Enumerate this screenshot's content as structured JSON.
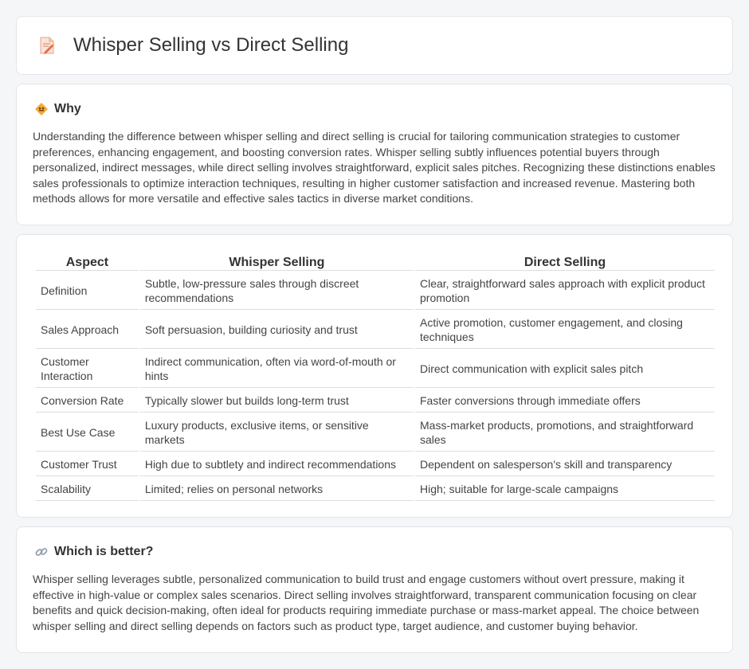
{
  "header": {
    "title": "Whisper Selling vs Direct Selling",
    "icon": "document-pencil-icon"
  },
  "why": {
    "title": "Why",
    "icon": "diamond-sign-icon",
    "text": "Understanding the difference between whisper selling and direct selling is crucial for tailoring communication strategies to customer preferences, enhancing engagement, and boosting conversion rates. Whisper selling subtly influences potential buyers through personalized, indirect messages, while direct selling involves straightforward, explicit sales pitches. Recognizing these distinctions enables sales professionals to optimize interaction techniques, resulting in higher customer satisfaction and increased revenue. Mastering both methods allows for more versatile and effective sales tactics in diverse market conditions."
  },
  "comparison": {
    "headers": [
      "Aspect",
      "Whisper Selling",
      "Direct Selling"
    ],
    "rows": [
      [
        "Definition",
        "Subtle, low-pressure sales through discreet recommendations",
        "Clear, straightforward sales approach with explicit product promotion"
      ],
      [
        "Sales Approach",
        "Soft persuasion, building curiosity and trust",
        "Active promotion, customer engagement, and closing techniques"
      ],
      [
        "Customer Interaction",
        "Indirect communication, often via word-of-mouth or hints",
        "Direct communication with explicit sales pitch"
      ],
      [
        "Conversion Rate",
        "Typically slower but builds long-term trust",
        "Faster conversions through immediate offers"
      ],
      [
        "Best Use Case",
        "Luxury products, exclusive items, or sensitive markets",
        "Mass-market products, promotions, and straightforward sales"
      ],
      [
        "Customer Trust",
        "High due to subtlety and indirect recommendations",
        "Dependent on salesperson's skill and transparency"
      ],
      [
        "Scalability",
        "Limited; relies on personal networks",
        "High; suitable for large-scale campaigns"
      ]
    ]
  },
  "better": {
    "title": "Which is better?",
    "icon": "link-icon",
    "text": "Whisper selling leverages subtle, personalized communication to build trust and engage customers without overt pressure, making it effective in high-value or complex sales scenarios. Direct selling involves straightforward, transparent communication focusing on clear benefits and quick decision-making, often ideal for products requiring immediate purchase or mass-market appeal. The choice between whisper selling and direct selling depends on factors such as product type, target audience, and customer buying behavior."
  },
  "colors": {
    "background": "#f5f6f8",
    "card": "#ffffff",
    "icon_orange": "#f2a93b",
    "icon_pink": "#e86a6a"
  }
}
